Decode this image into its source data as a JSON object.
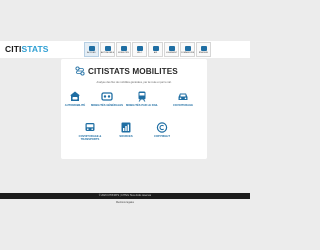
{
  "brand": {
    "part1": "CITI",
    "part2": "STATS"
  },
  "nav": [
    {
      "label": "ACCUEIL",
      "active": true
    },
    {
      "label": "AUTOMOBILE"
    },
    {
      "label": "MOBILITÉS"
    },
    {
      "label": "VÉLO"
    },
    {
      "label": "AIR"
    },
    {
      "label": "LOGEMENT"
    },
    {
      "label": "COMMERCES"
    },
    {
      "label": "ÉNERGIE"
    }
  ],
  "main": {
    "title": "CITISTATS MOBILITES",
    "subtitle": "Analyse des flux de mobilités générales, par la route et par le rail.",
    "tiles": [
      {
        "label": "Automobilité",
        "icon": "car-icon"
      },
      {
        "label": "Mobilités générales",
        "icon": "mobility-icon"
      },
      {
        "label": "Mobilités par le rail",
        "icon": "train-icon"
      },
      {
        "label": "Covoiturage",
        "icon": "carpool-icon"
      },
      {
        "label": "Covoiturage & Transports",
        "icon": "bus-icon"
      },
      {
        "label": "Sources",
        "icon": "sources-icon"
      },
      {
        "label": "Copyright",
        "icon": "copyright-icon"
      }
    ]
  },
  "footer": {
    "text": "© 2023 CITISTATS | CITIVIL Tous droits réservés",
    "link": "Mentions légales"
  },
  "colors": {
    "accent": "#2f9fd3",
    "icon": "#1f6ea3",
    "footer_bg": "#1b1b1b"
  }
}
